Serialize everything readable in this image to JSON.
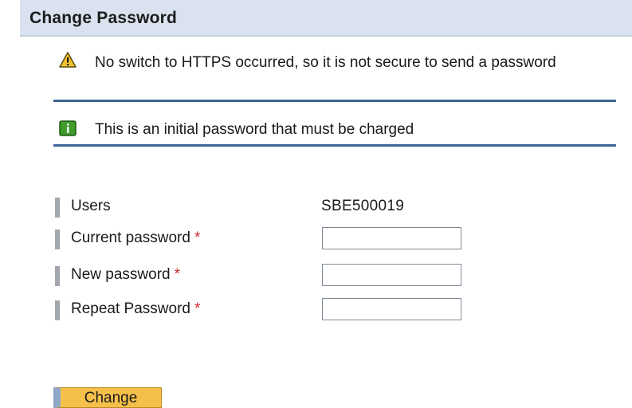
{
  "header": {
    "title": "Change Password"
  },
  "messages": {
    "warning": {
      "icon": "warning-triangle-icon",
      "text": "No switch to HTTPS occurred, so it is not secure to send a password"
    },
    "info": {
      "icon": "info-icon",
      "text": "This is an initial password that must be charged"
    }
  },
  "form": {
    "users_label": "Users",
    "users_value": "SBE500019",
    "current_password_label": "Current password",
    "new_password_label": "New password",
    "repeat_password_label": "Repeat Password",
    "required_marker": "*",
    "current_password_value": "",
    "new_password_value": "",
    "repeat_password_value": ""
  },
  "actions": {
    "change_label": "Change"
  },
  "colors": {
    "title_bar": "#d9e2ee",
    "separator": "#3b6693",
    "required": "#d12b2b",
    "button": "#f5c04a",
    "button_accent": "#8fa7c9",
    "warning_icon": "#f2c230",
    "info_icon": "#3f9b2c"
  }
}
